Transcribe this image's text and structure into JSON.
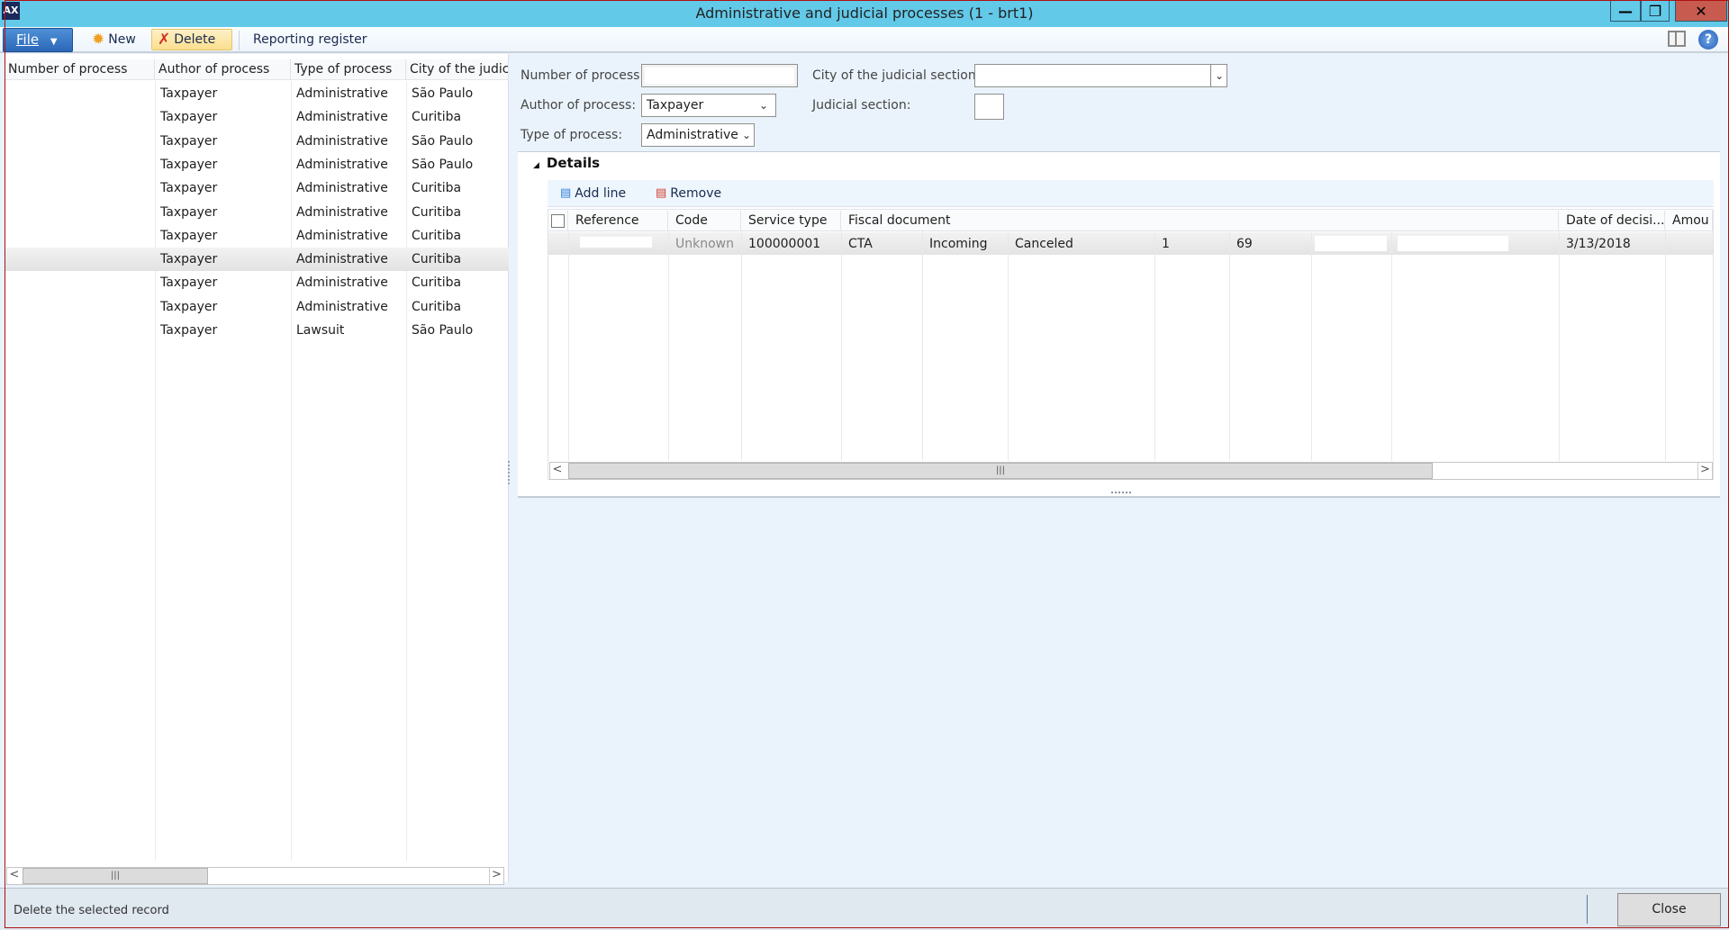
{
  "window": {
    "title": "Administrative and judicial processes (1 - brt1)",
    "app_icon": "ax-icon",
    "controls": {
      "minimize": "—",
      "restore": "❐",
      "close": "✕"
    }
  },
  "toolbar": {
    "file_label": "File",
    "new_label": "New",
    "delete_label": "Delete",
    "reporting_label": "Reporting register"
  },
  "list": {
    "columns": [
      "Number of process",
      "Author of process",
      "Type of process",
      "City of the judic"
    ],
    "rows": [
      {
        "number": "",
        "author": "Taxpayer",
        "type": "Administrative",
        "city": "São Paulo"
      },
      {
        "number": "",
        "author": "Taxpayer",
        "type": "Administrative",
        "city": "Curitiba"
      },
      {
        "number": "",
        "author": "Taxpayer",
        "type": "Administrative",
        "city": "São Paulo"
      },
      {
        "number": "",
        "author": "Taxpayer",
        "type": "Administrative",
        "city": "São Paulo"
      },
      {
        "number": "",
        "author": "Taxpayer",
        "type": "Administrative",
        "city": "Curitiba"
      },
      {
        "number": "",
        "author": "Taxpayer",
        "type": "Administrative",
        "city": "Curitiba"
      },
      {
        "number": "",
        "author": "Taxpayer",
        "type": "Administrative",
        "city": "Curitiba"
      },
      {
        "number": "",
        "author": "Taxpayer",
        "type": "Administrative",
        "city": "Curitiba",
        "selected": true
      },
      {
        "number": "",
        "author": "Taxpayer",
        "type": "Administrative",
        "city": "Curitiba"
      },
      {
        "number": "",
        "author": "Taxpayer",
        "type": "Administrative",
        "city": "Curitiba"
      },
      {
        "number": "",
        "author": "Taxpayer",
        "type": "Lawsuit",
        "city": "São Paulo"
      }
    ]
  },
  "form": {
    "number_label": "Number of process:",
    "number_value": "",
    "author_label": "Author of process:",
    "author_value": "Taxpayer",
    "type_label": "Type of process:",
    "type_value": "Administrative",
    "city_label": "City of the judicial section:",
    "city_value": "",
    "judicial_label": "Judicial section:",
    "judicial_value": ""
  },
  "details": {
    "title": "Details",
    "add_line_label": "Add line",
    "remove_label": "Remove",
    "columns": [
      "Reference",
      "Code",
      "Service type",
      "Fiscal document",
      "Date of decisi...",
      "Amou"
    ],
    "rows": [
      {
        "reference": "",
        "code": "Unknown",
        "service_type": "100000001",
        "fiscal_doc": [
          "CTA",
          "Incoming",
          "Canceled",
          "1",
          "69",
          "",
          ""
        ],
        "date": "3/13/2018",
        "amount": ""
      }
    ]
  },
  "status": {
    "text": "Delete the selected record",
    "close_label": "Close"
  }
}
